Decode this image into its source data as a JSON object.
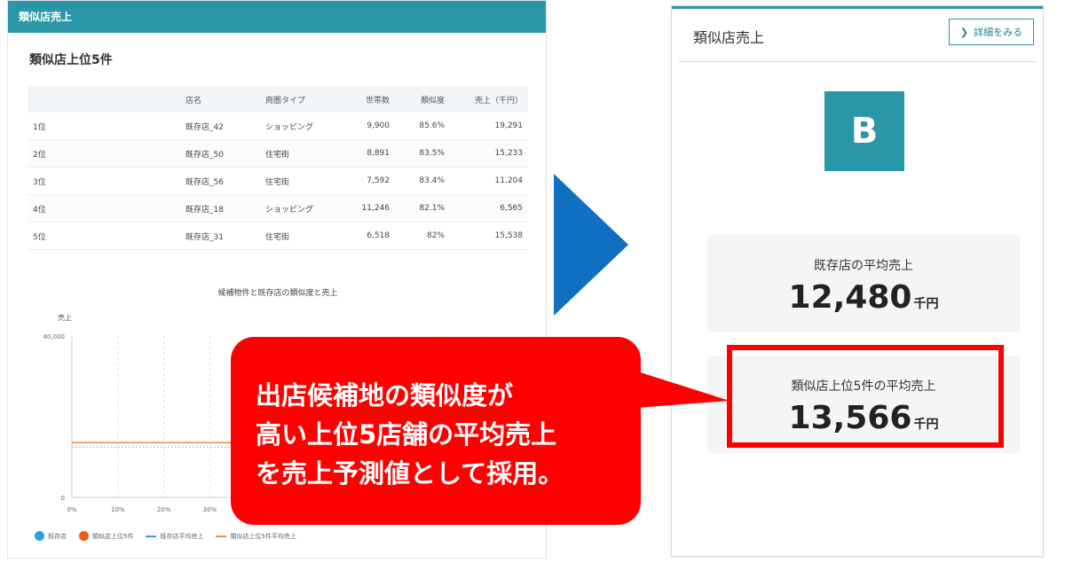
{
  "left": {
    "header": "類似店売上",
    "section_title": "類似店上位5件",
    "columns": [
      "",
      "店名",
      "商圏タイプ",
      "世帯数",
      "類似度",
      "売上（千円）"
    ],
    "rows": [
      {
        "rank": "1位",
        "name": "既存店_42",
        "type": "ショッピング",
        "households": "9,900",
        "similarity": "85.6%",
        "sales": "19,291"
      },
      {
        "rank": "2位",
        "name": "既存店_50",
        "type": "住宅街",
        "households": "8,891",
        "similarity": "83.5%",
        "sales": "15,233"
      },
      {
        "rank": "3位",
        "name": "既存店_56",
        "type": "住宅街",
        "households": "7,592",
        "similarity": "83.4%",
        "sales": "11,204"
      },
      {
        "rank": "4位",
        "name": "既存店_18",
        "type": "ショッピング",
        "households": "11,246",
        "similarity": "82.1%",
        "sales": "6,565"
      },
      {
        "rank": "5位",
        "name": "既存店_31",
        "type": "住宅街",
        "households": "6,518",
        "similarity": "82%",
        "sales": "15,538"
      }
    ]
  },
  "chart_data": {
    "type": "scatter",
    "title": "候補物件と既存店の類似度と売上",
    "ylabel": "売上",
    "y_ticks": [
      "40,000",
      "0"
    ],
    "x_ticks": [
      "0%",
      "10%",
      "20%",
      "30%"
    ],
    "ylim": [
      0,
      40000
    ],
    "xlim": [
      0,
      100
    ],
    "reference_lines": [
      {
        "name": "既存店平均売上",
        "value": 12480,
        "color": "#9fb4c4"
      },
      {
        "name": "類似店上位5件平均売上",
        "value": 13566,
        "color": "#f08a3c"
      }
    ],
    "legend": [
      {
        "name": "既存店",
        "color": "#2f9fe0",
        "kind": "dot"
      },
      {
        "name": "類似店上位5件",
        "color": "#f05a1a",
        "kind": "dot"
      },
      {
        "name": "既存店平均売上",
        "color": "#2f9fe0",
        "kind": "line"
      },
      {
        "name": "類似店上位5件平均売上",
        "color": "#f08a3c",
        "kind": "line"
      }
    ]
  },
  "right": {
    "title": "類似店売上",
    "detail_button": "詳細をみる",
    "grade": "B",
    "avg_label": "既存店の平均売上",
    "avg_value": "12,480",
    "avg_unit": "千円",
    "top5_label": "類似店上位5件の平均売上",
    "top5_value": "13,566",
    "top5_unit": "千円"
  },
  "callout": {
    "lines": [
      "出店候補地の類似度が",
      "高い上位5店舗の平均売上",
      "を売上予測値として採用。"
    ]
  },
  "colors": {
    "teal": "#2a97a8",
    "arrow_blue": "#0f6fc0",
    "callout_red": "#ff0000"
  }
}
